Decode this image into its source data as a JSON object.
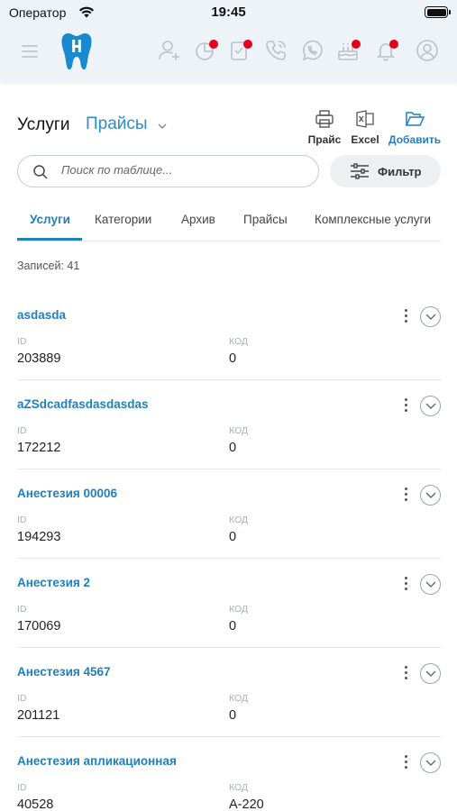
{
  "status_bar": {
    "carrier": "Оператор",
    "time": "19:45"
  },
  "page": {
    "title": "Услуги",
    "price_select": "Прайсы"
  },
  "actions": {
    "print": "Прайс",
    "excel": "Excel",
    "add": "Добавить"
  },
  "search": {
    "placeholder": "Поиск по таблице..."
  },
  "filter": {
    "label": "Фильтр"
  },
  "tabs": [
    "Услуги",
    "Категории",
    "Архив",
    "Прайсы",
    "Комплексные услуги"
  ],
  "records": "Записей: 41",
  "field_labels": {
    "id": "ID",
    "code": "КОД"
  },
  "items": [
    {
      "name": "asdasda",
      "id": "203889",
      "code": "0"
    },
    {
      "name": "aZSdcadfasdasdasdas",
      "id": "172212",
      "code": "0"
    },
    {
      "name": "Анестезия 00006",
      "id": "194293",
      "code": "0"
    },
    {
      "name": "Анестезия 2",
      "id": "170069",
      "code": "0"
    },
    {
      "name": "Анестезия 4567",
      "id": "201121",
      "code": "0"
    },
    {
      "name": "Анестезия апликационная",
      "id": "40528",
      "code": "A-220"
    }
  ],
  "colors": {
    "accent": "#1f7fbf",
    "notification": "#e3001b",
    "header_bg": "#eef3f8"
  }
}
